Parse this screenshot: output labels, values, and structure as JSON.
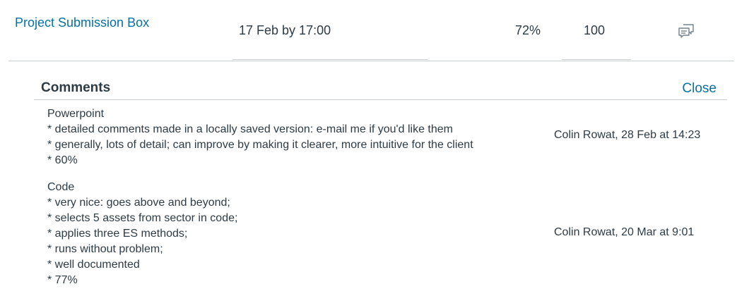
{
  "assignment": {
    "name": "Project Submission Box",
    "due": "17 Feb by 17:00",
    "score": "72%",
    "points": "100"
  },
  "icons": {
    "comment_toggle": "speech-bubbles-icon"
  },
  "comments_panel": {
    "heading": "Comments",
    "close_label": "Close",
    "comments": [
      {
        "lines": [
          "Powerpoint",
          "* detailed comments made in a locally saved version: e-mail me if you'd like them",
          "* generally, lots of detail; can improve by making it clearer, more intuitive for the client",
          "* 60%"
        ],
        "meta": "Colin Rowat, 28 Feb at 14:23"
      },
      {
        "lines": [
          "Code",
          "* very nice: goes above and beyond;",
          "* selects 5 assets from sector in code;",
          "* applies three ES methods;",
          "* runs without problem;",
          "* well documented",
          "* 77%"
        ],
        "meta": "Colin Rowat, 20 Mar at 9:01"
      }
    ]
  },
  "colors": {
    "link": "#0770a3",
    "text": "#2d3b45",
    "divider": "#c7cdd1"
  }
}
